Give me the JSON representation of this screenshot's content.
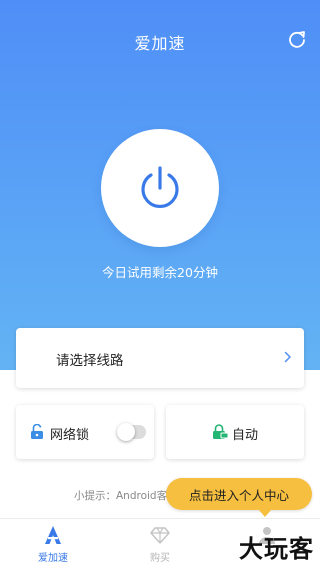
{
  "app": {
    "title": "爱加速"
  },
  "power": {
    "trial_text": "今日试用剩余20分钟"
  },
  "route": {
    "label": "请选择线路"
  },
  "network_lock": {
    "label": "网络锁",
    "enabled": false
  },
  "mode": {
    "label": "自动"
  },
  "tip": {
    "text": "小提示：Android客户",
    "bubble": "点击进入个人中心"
  },
  "tabs": [
    {
      "label": "爱加速",
      "icon": "speed-logo-icon",
      "active": true
    },
    {
      "label": "购买",
      "icon": "diamond-icon",
      "active": false
    },
    {
      "label": "",
      "icon": "person-icon",
      "active": false
    }
  ],
  "watermark": "大玩客",
  "colors": {
    "accent": "#3a7ae8",
    "hero_top": "#4f8ef7",
    "hero_bottom": "#63b3f4",
    "bubble": "#f6bf3f",
    "lock_blue": "#3a8ee6",
    "auto_green": "#22b573"
  }
}
